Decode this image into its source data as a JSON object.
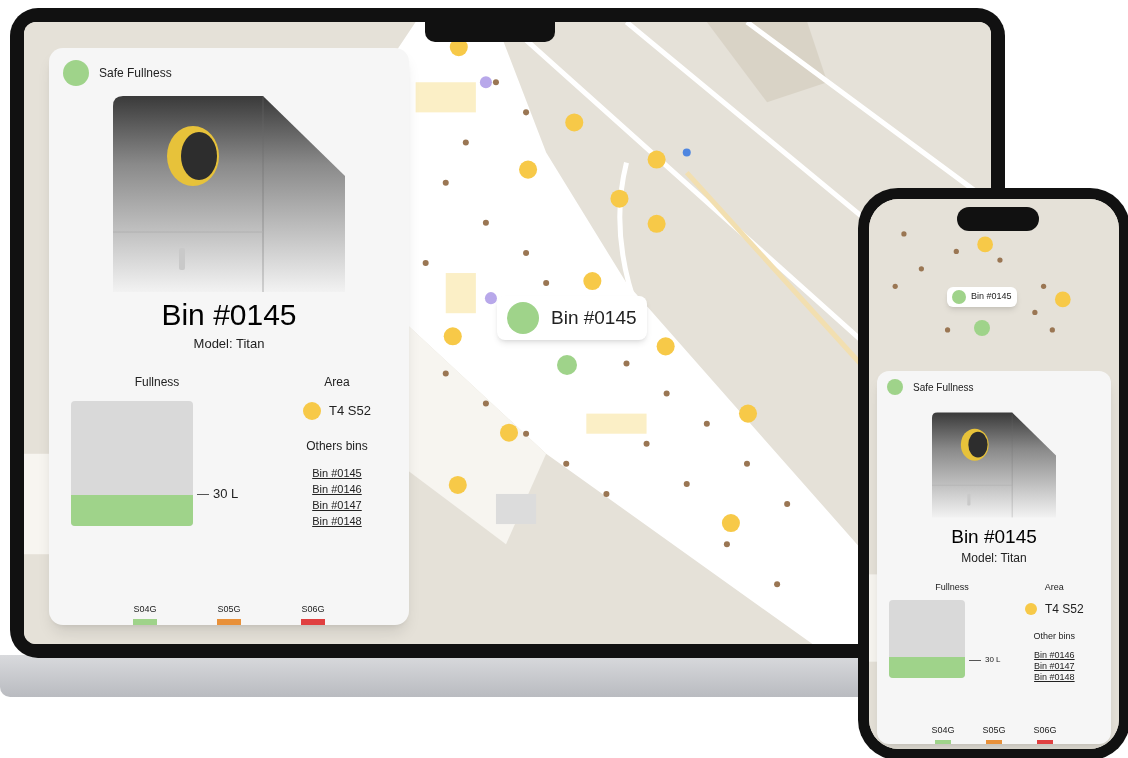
{
  "laptop": {
    "map_tooltip": {
      "label": "Bin #0145",
      "color": "#9fd38a"
    },
    "panel": {
      "status": {
        "label": "Safe Fullness",
        "color": "#9fd38a"
      },
      "title": "Bin #0145",
      "model": "Model: Titan",
      "fullness": {
        "label": "Fullness",
        "level": 0.25,
        "reading": "30 L",
        "color": "#9fd38a"
      },
      "area": {
        "label": "Area",
        "value": "T4 S52",
        "color": "#f7c948"
      },
      "other_bins": {
        "label": "Others bins",
        "links": [
          "Bin #0145",
          "Bin #0146",
          "Bin #0147",
          "Bin #0148"
        ]
      },
      "legend": [
        {
          "label": "S04G",
          "color": "#9fd38a"
        },
        {
          "label": "S05G",
          "color": "#e8913a"
        },
        {
          "label": "S06G",
          "color": "#e04040"
        }
      ]
    }
  },
  "phone": {
    "map_tooltip": {
      "label": "Bin #0145",
      "color": "#9fd38a"
    },
    "panel": {
      "status": {
        "label": "Safe Fullness",
        "color": "#9fd38a"
      },
      "title": "Bin #0145",
      "model": "Model: Titan",
      "fullness": {
        "label": "Fullness",
        "level": 0.27,
        "reading": "30 L",
        "color": "#9fd38a"
      },
      "area": {
        "label": "Area",
        "value": "T4 S52",
        "color": "#f7c948"
      },
      "other_bins": {
        "label": "Other bins",
        "links": [
          "Bin #0146",
          "Bin #0147",
          "Bin #0148"
        ]
      },
      "legend": [
        {
          "label": "S04G",
          "color": "#9fd38a"
        },
        {
          "label": "S05G",
          "color": "#e8913a"
        },
        {
          "label": "S06G",
          "color": "#e04040"
        }
      ]
    }
  }
}
